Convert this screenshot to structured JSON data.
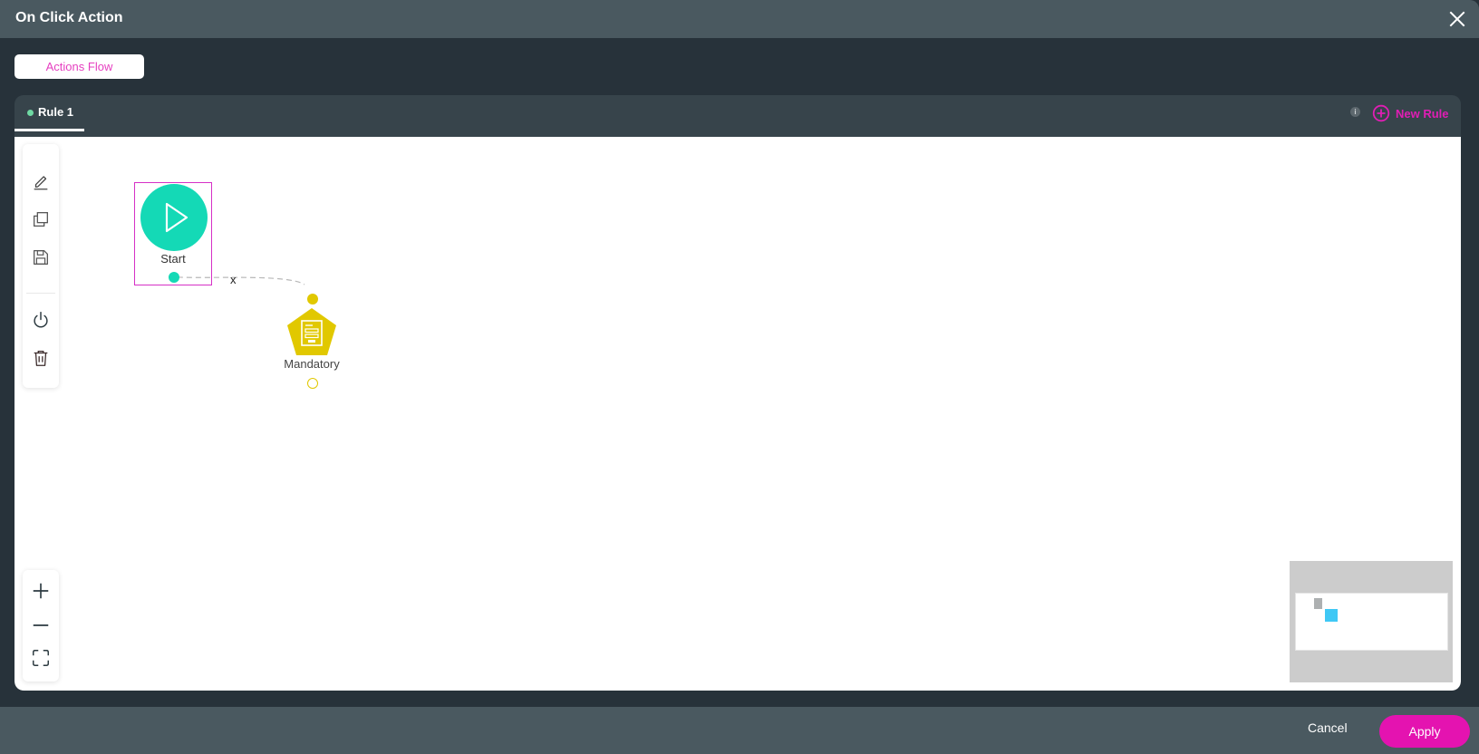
{
  "modal": {
    "title": "On Click Action",
    "close_icon": "close-icon"
  },
  "tabs": {
    "actions_flow_label": "Actions Flow"
  },
  "rule_panel": {
    "rules": [
      {
        "label": "Rule 1",
        "active": true,
        "status_color": "#6fd9a3"
      }
    ],
    "info_glyph": "i",
    "new_rule_label": "New Rule"
  },
  "toolbar": {
    "tools": [
      {
        "name": "edit",
        "icon": "pencil-icon"
      },
      {
        "name": "duplicate",
        "icon": "copy-icon"
      },
      {
        "name": "save",
        "icon": "save-icon"
      },
      {
        "name": "toggle-power",
        "icon": "power-icon"
      },
      {
        "name": "delete",
        "icon": "trash-icon"
      }
    ],
    "zoom_tools": [
      {
        "name": "zoom-in",
        "icon": "plus-icon"
      },
      {
        "name": "zoom-out",
        "icon": "minus-icon"
      },
      {
        "name": "fit-to-screen",
        "icon": "fit-screen-icon"
      }
    ]
  },
  "flow": {
    "nodes": [
      {
        "id": "start",
        "label": "Start",
        "type": "start",
        "color": "#14d9b6",
        "selected": true
      },
      {
        "id": "mandatory",
        "label": "Mandatory",
        "type": "form",
        "color": "#e1c800",
        "selected": false
      }
    ],
    "edges": [
      {
        "from": "start",
        "to": "mandatory",
        "delete_glyph": "x"
      }
    ]
  },
  "footer": {
    "cancel_label": "Cancel",
    "apply_label": "Apply"
  },
  "colors": {
    "accent": "#e413b0",
    "header_bg": "#4a5960",
    "body_bg": "#27323a"
  }
}
